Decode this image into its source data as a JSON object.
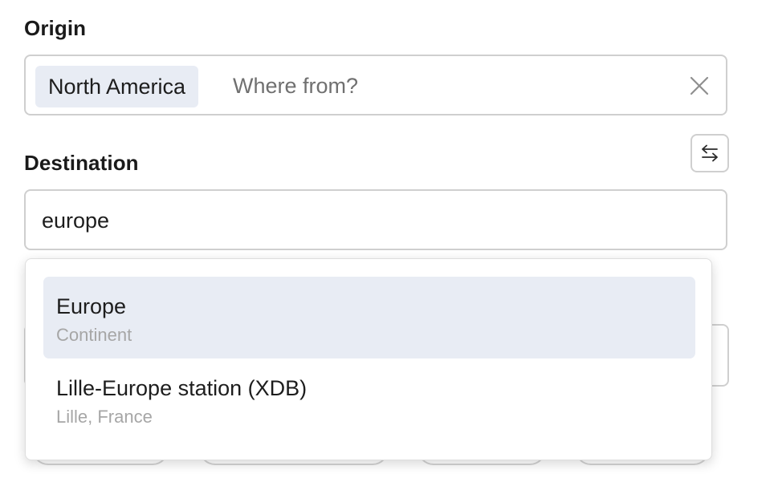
{
  "origin": {
    "label": "Origin",
    "chip": "North America",
    "placeholder": "Where from?",
    "clear_icon": "close-icon"
  },
  "swap": {
    "icon": "swap-arrows-icon"
  },
  "destination": {
    "label": "Destination",
    "value": "europe"
  },
  "suggestions": [
    {
      "title": "Europe",
      "subtitle": "Continent",
      "highlighted": true
    },
    {
      "title": "Lille-Europe station (XDB)",
      "subtitle": "Lille, France",
      "highlighted": false
    }
  ],
  "colors": {
    "highlight": "#e8ecf4",
    "border": "#cfcfcf",
    "placeholder": "#707070",
    "subtitle": "#a6a6a6"
  }
}
